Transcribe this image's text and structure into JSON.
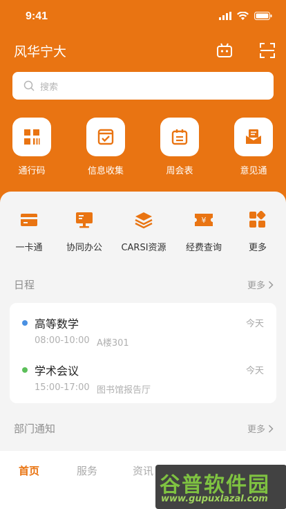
{
  "status_bar": {
    "time": "9:41"
  },
  "header": {
    "title": "风华宁大",
    "icons": [
      "robot-icon",
      "scan-icon"
    ]
  },
  "search": {
    "placeholder": "搜索"
  },
  "quick_actions": [
    {
      "label": "通行码",
      "icon": "pass-code-icon"
    },
    {
      "label": "信息收集",
      "icon": "info-collect-icon"
    },
    {
      "label": "周会表",
      "icon": "calendar-icon"
    },
    {
      "label": "意见通",
      "icon": "feedback-mail-icon"
    }
  ],
  "services": [
    {
      "label": "一卡通",
      "icon": "card-icon"
    },
    {
      "label": "协同办公",
      "icon": "monitor-icon"
    },
    {
      "label": "CARSI资源",
      "icon": "layers-icon"
    },
    {
      "label": "经费查询",
      "icon": "yuan-ticket-icon"
    },
    {
      "label": "更多",
      "icon": "grid-more-icon"
    }
  ],
  "schedule": {
    "title": "日程",
    "more": "更多",
    "events": [
      {
        "title": "高等数学",
        "day": "今天",
        "time": "08:00-10:00",
        "room": "A楼301",
        "dot_color": "#4a90e2"
      },
      {
        "title": "学术会议",
        "day": "今天",
        "time": "15:00-17:00",
        "room": "图书馆报告厅",
        "dot_color": "#5cbf5a"
      }
    ]
  },
  "notices": {
    "title": "部门通知",
    "more": "更多"
  },
  "tabbar": {
    "tabs": [
      "首页",
      "服务",
      "资讯"
    ],
    "active": "首页"
  },
  "watermark": {
    "big": "谷普软件园",
    "small": "www.gupuxlazal.com"
  },
  "colors": {
    "brand": "#e97412",
    "background": "#f4f4f4"
  }
}
